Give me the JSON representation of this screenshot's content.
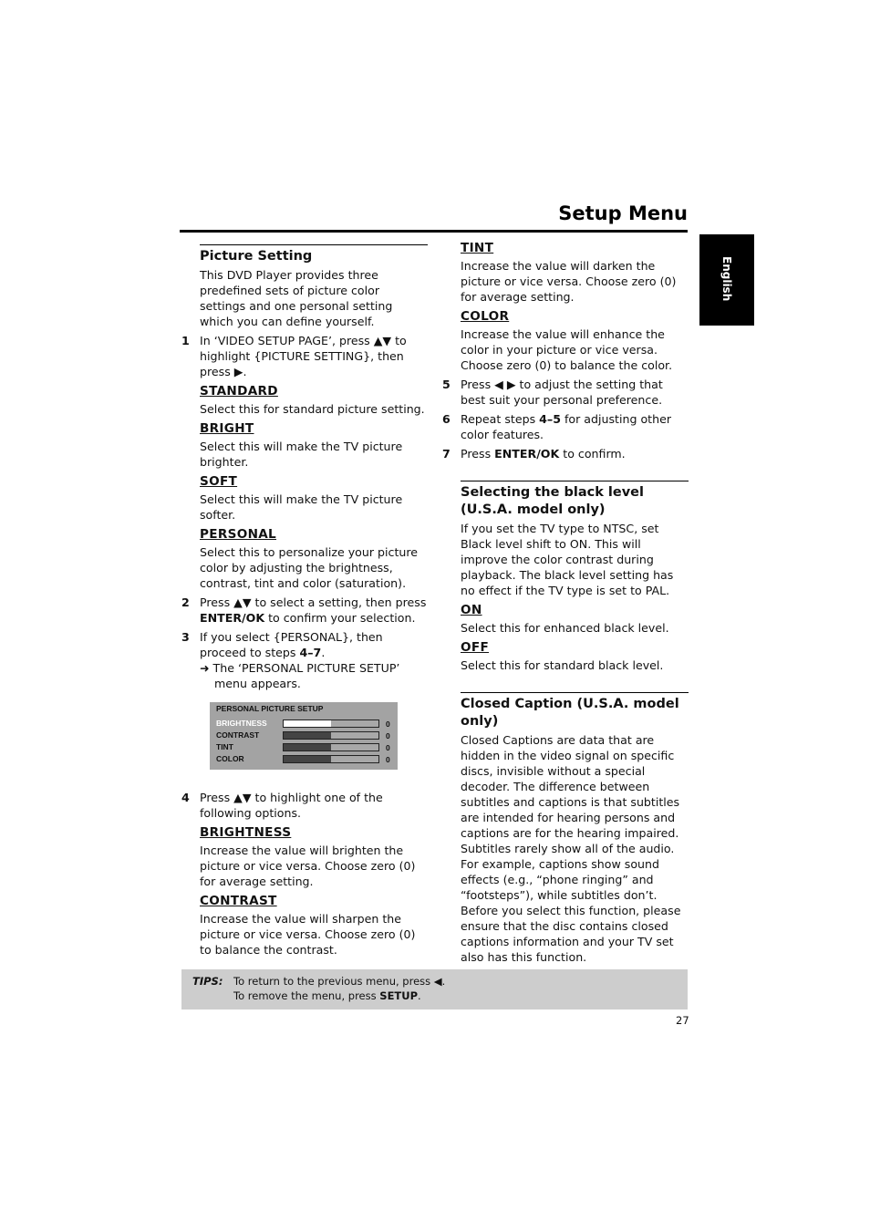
{
  "header": {
    "title": "Setup Menu",
    "language_tab": "English"
  },
  "picture_setting": {
    "title": "Picture Setting",
    "intro": "This DVD Player provides three predefined sets of picture color settings and one personal setting which you can define yourself.",
    "step1": {
      "num": "1",
      "text": "In ‘VIDEO SETUP PAGE’, press ▲▼ to highlight {PICTURE SETTING}, then press ▶."
    },
    "options": [
      {
        "label": "STANDARD",
        "desc": "Select this for standard picture setting."
      },
      {
        "label": "BRIGHT",
        "desc": "Select this will make the TV picture brighter."
      },
      {
        "label": "SOFT",
        "desc": "Select this will make the TV picture softer."
      },
      {
        "label": "PERSONAL",
        "desc": "Select this to personalize your picture color by adjusting the brightness, contrast, tint and color (saturation)."
      }
    ],
    "step2": {
      "num": "2",
      "pre": "Press ▲▼ to select a setting, then press ",
      "bold": "ENTER/OK",
      "post": " to confirm your selection."
    },
    "step3": {
      "num": "3",
      "pre": "If you select {PERSONAL}, then proceed to steps ",
      "bold": "4–7",
      "post": ".",
      "result": "➜ The ‘PERSONAL PICTURE SETUP’ menu appears."
    },
    "osd": {
      "title": "PERSONAL PICTURE SETUP",
      "rows": [
        {
          "label": "BRIGHTNESS",
          "value": "0",
          "level": 0.5,
          "active": true
        },
        {
          "label": "CONTRAST",
          "value": "0",
          "level": 0.5,
          "active": false
        },
        {
          "label": "TINT",
          "value": "0",
          "level": 0.5,
          "active": false
        },
        {
          "label": "COLOR",
          "value": "0",
          "level": 0.5,
          "active": false
        }
      ]
    },
    "step4": {
      "num": "4",
      "text": "Press ▲▼ to highlight one of the following options."
    },
    "adjust_options": [
      {
        "label": "BRIGHTNESS",
        "desc": "Increase the value will brighten the picture or vice versa. Choose zero (0) for average setting."
      },
      {
        "label": "CONTRAST",
        "desc": "Increase the value will sharpen the picture or vice versa. Choose zero (0) to balance the contrast."
      },
      {
        "label": "TINT",
        "desc": "Increase the value will darken the picture or vice versa. Choose zero (0) for average setting."
      },
      {
        "label": "COLOR",
        "desc": "Increase the value will enhance the color in your picture or vice versa. Choose zero (0) to balance the color."
      }
    ],
    "step5": {
      "num": "5",
      "text": "Press ◀ ▶ to adjust the setting that best suit your personal preference."
    },
    "step6": {
      "num": "6",
      "pre": "Repeat steps ",
      "bold": "4–5",
      "post": " for adjusting other color features."
    },
    "step7": {
      "num": "7",
      "pre": "Press ",
      "bold": "ENTER/OK",
      "post": " to confirm."
    }
  },
  "black_level": {
    "title": "Selecting the black level (U.S.A. model only)",
    "intro": "If you set the TV type to NTSC, set Black level shift to ON. This will improve the color contrast during playback. The black level setting has no effect if the TV type is set to PAL.",
    "options": [
      {
        "label": "ON",
        "desc": "Select this for enhanced black level."
      },
      {
        "label": "OFF",
        "desc": "Select this for standard black level."
      }
    ]
  },
  "closed_caption": {
    "title": "Closed Caption (U.S.A. model only)",
    "body": "Closed Captions are data that are hidden in the video signal on specific discs, invisible without a special decoder. The difference between subtitles and captions is that subtitles are intended for hearing persons and captions are for the hearing impaired. Subtitles rarely show all of the audio. For example, captions show sound effects (e.g., “phone ringing” and “footsteps”), while subtitles don’t. Before you select this function, please ensure that the disc contains closed captions information and your TV set also has this function."
  },
  "tips": {
    "label": "TIPS:",
    "line1": "To return to the previous menu, press ◀.",
    "line2_pre": "To remove the menu, press ",
    "line2_bold": "SETUP",
    "line2_post": "."
  },
  "page_number": "27"
}
